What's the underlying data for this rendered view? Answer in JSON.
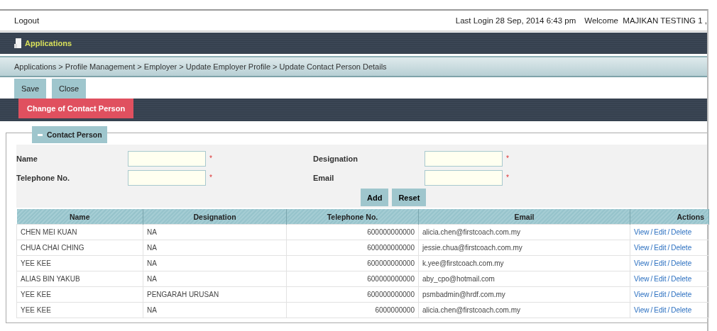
{
  "header": {
    "logout": "Logout",
    "last_login": "Last Login 28 Sep, 2014 6:43 pm",
    "welcome": "Welcome  MAJIKAN TESTING 1 ,"
  },
  "nav": {
    "label": "Applications"
  },
  "breadcrumb": "Applications > Profile Management > Employer > Update Employer Profile > Update Contact Person Details",
  "toolbar": [
    "Save",
    "Close"
  ],
  "tabs": [
    {
      "label": "Change of Contact Person",
      "selected": true
    }
  ],
  "section": {
    "title": "Contact Person",
    "expanded": true
  },
  "form": {
    "fields": [
      {
        "label": "Name",
        "required": true
      },
      {
        "label": "Designation",
        "required": true
      },
      {
        "label": "Telephone No.",
        "required": true
      },
      {
        "label": "Email",
        "required": true
      }
    ],
    "required_mark": "*",
    "buttons": [
      "Add",
      "Reset"
    ]
  },
  "table": {
    "columns": [
      "Name",
      "Designation",
      "Telephone No.",
      "Email",
      "Actions"
    ],
    "rows": [
      {
        "name": "CHEN MEI KUAN",
        "designation": "NA",
        "telephone": "600000000000",
        "email": "alicia.chen@firstcoach.com.my",
        "actions": [
          "View",
          "Edit",
          "Delete"
        ]
      },
      {
        "name": "CHUA CHAI CHING",
        "designation": "NA",
        "telephone": "600000000000",
        "email": "jessie.chua@firstcoach.com.my",
        "actions": [
          "View",
          "Edit",
          "Delete"
        ]
      },
      {
        "name": "YEE KEE",
        "designation": "NA",
        "telephone": "600000000000",
        "email": "k.yee@firstcoach.com.my",
        "actions": [
          "View",
          "Edit",
          "Delete"
        ]
      },
      {
        "name": "ALIAS BIN YAKUB",
        "designation": "NA",
        "telephone": "600000000000",
        "email": "aby_cpo@hotmail.com",
        "actions": [
          "View",
          "Edit",
          "Delete"
        ]
      },
      {
        "name": "YEE KEE",
        "designation": "PENGARAH URUSAN",
        "telephone": "600000000000",
        "email": "psmbadmin@hrdf.com.my",
        "actions": [
          "View",
          "Edit",
          "Delete"
        ]
      },
      {
        "name": "YEE KEE",
        "designation": "NA",
        "telephone": "6000000000",
        "email": "alicia.chen@firstcoach.com.my",
        "actions": [
          "View",
          "Edit",
          "Delete"
        ]
      }
    ],
    "action_separator": "/"
  }
}
